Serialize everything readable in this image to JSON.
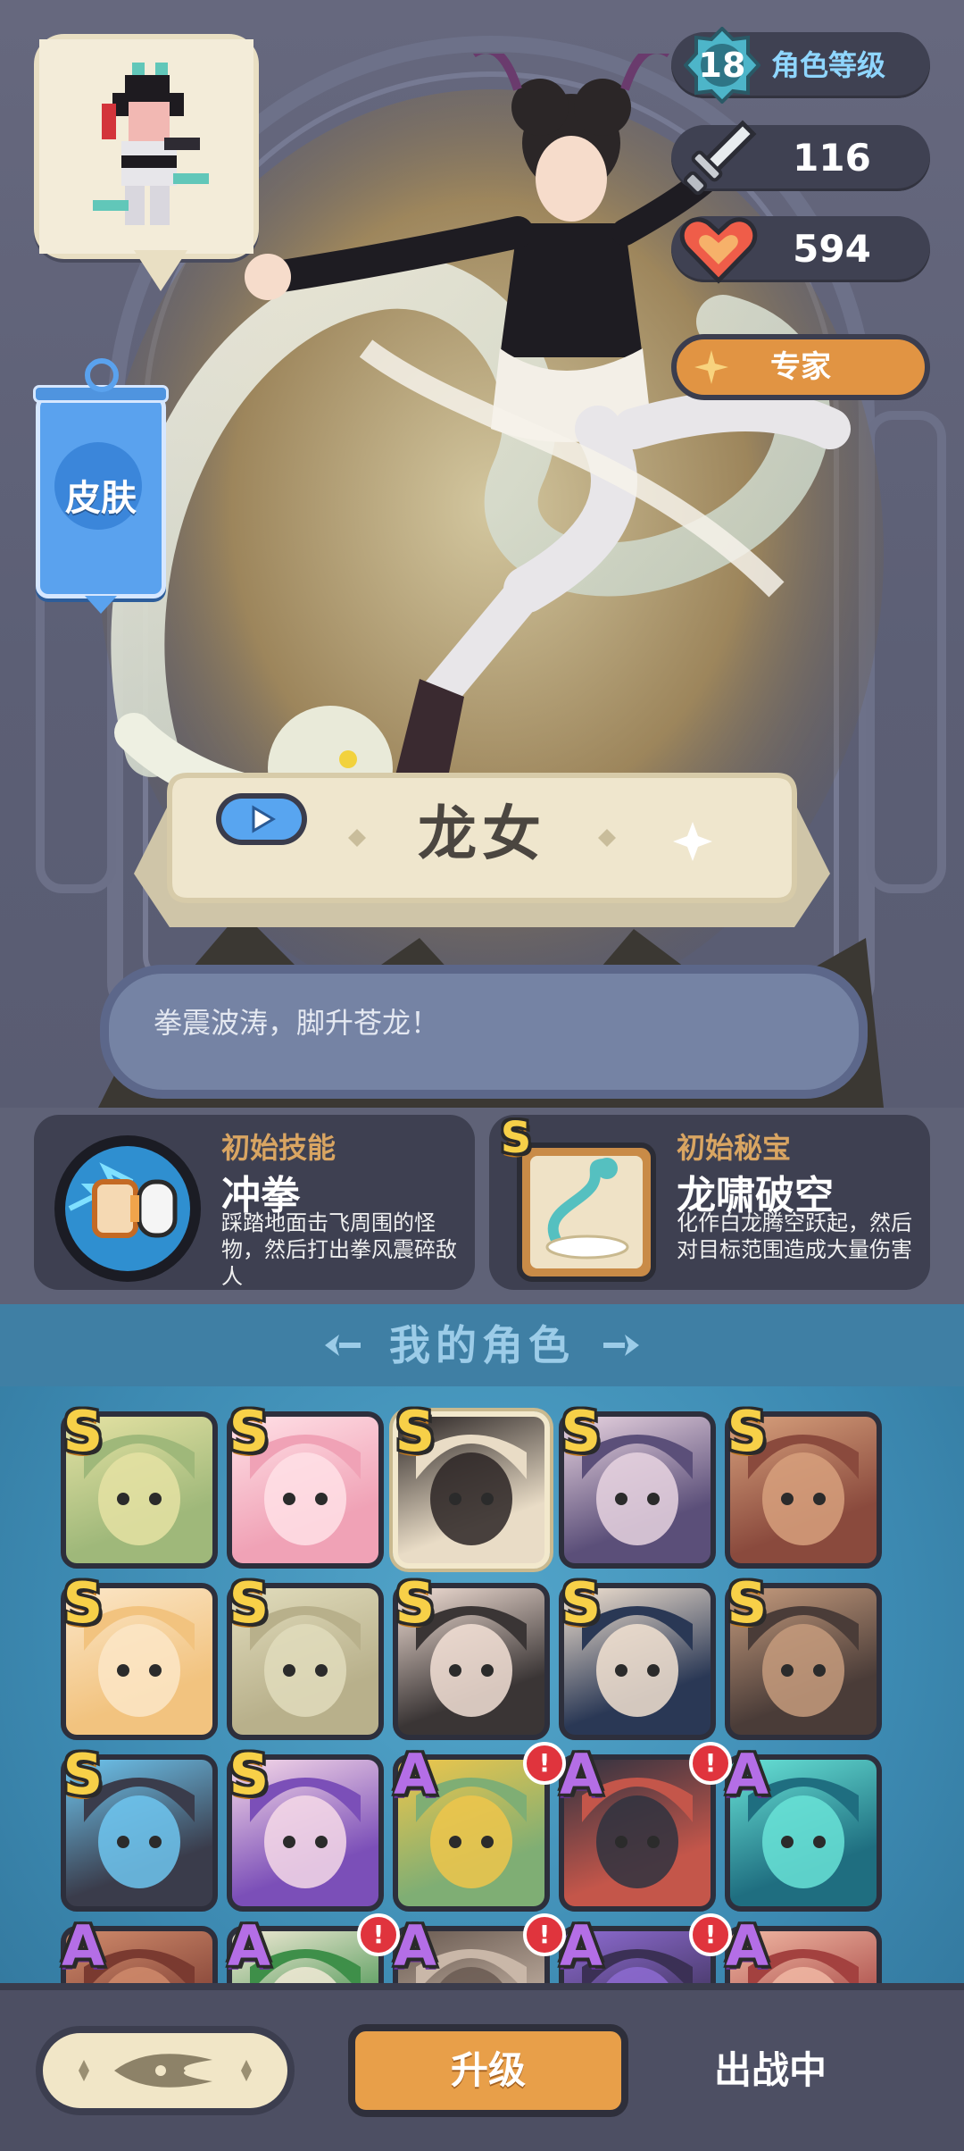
{
  "hero": {
    "skin_label": "皮肤",
    "level": "18",
    "level_label": "角色等级",
    "attack": "116",
    "health": "594",
    "rank_label": "专家",
    "name": "龙女",
    "quote": "拳震波涛，脚升苍龙！"
  },
  "skills": {
    "basic": {
      "tag": "初始技能",
      "name": "冲拳",
      "desc": "踩踏地面击飞周围的怪物，然后打出拳风震碎敌人"
    },
    "treasure": {
      "tag": "初始秘宝",
      "grade": "S",
      "name": "龙啸破空",
      "desc": "化作白龙腾空跃起，然后对目标范围造成大量伤害"
    }
  },
  "roster": {
    "title": "我的角色",
    "cards": [
      {
        "rank": "S",
        "color": "#9fb87a",
        "accent": "#e5e2a3",
        "alert": false,
        "selected": false
      },
      {
        "rank": "S",
        "color": "#f0a2b6",
        "accent": "#ffe0e6",
        "alert": false,
        "selected": false
      },
      {
        "rank": "S",
        "color": "#e9dcc6",
        "accent": "#2b2525",
        "alert": false,
        "selected": true
      },
      {
        "rank": "S",
        "color": "#5b4f79",
        "accent": "#e8d3e0",
        "alert": false,
        "selected": false
      },
      {
        "rank": "S",
        "color": "#8a4a3d",
        "accent": "#d7a07c",
        "alert": false,
        "selected": false
      },
      {
        "rank": "S",
        "color": "#f2c37f",
        "accent": "#fbe6c7",
        "alert": false,
        "selected": false
      },
      {
        "rank": "S",
        "color": "#b8b08b",
        "accent": "#e1dcbc",
        "alert": false,
        "selected": false
      },
      {
        "rank": "S",
        "color": "#3a3535",
        "accent": "#f3e0d6",
        "alert": false,
        "selected": false
      },
      {
        "rank": "S",
        "color": "#2a3855",
        "accent": "#f2e2d1",
        "alert": false,
        "selected": false
      },
      {
        "rank": "S",
        "color": "#4a3c38",
        "accent": "#c59b7d",
        "alert": false,
        "selected": false
      },
      {
        "rank": "S",
        "color": "#3a3c4b",
        "accent": "#6ec6f0",
        "alert": false,
        "selected": false
      },
      {
        "rank": "S",
        "color": "#7b4fb8",
        "accent": "#f6d9e8",
        "alert": false,
        "selected": false
      },
      {
        "rank": "A",
        "color": "#7fae74",
        "accent": "#efc64b",
        "alert": false,
        "selected": false
      },
      {
        "rank": "A",
        "color": "#c4564a",
        "accent": "#2f3240",
        "alert": true,
        "selected": false
      },
      {
        "rank": "A",
        "color": "#1f6e80",
        "accent": "#68e3d7",
        "alert": true,
        "selected": false
      },
      {
        "rank": "A",
        "color": "#7a3a30",
        "accent": "#cf8a6b",
        "alert": false,
        "selected": false
      },
      {
        "rank": "A",
        "color": "#3e8f49",
        "accent": "#f0e9d5",
        "alert": false,
        "selected": false
      },
      {
        "rank": "A",
        "color": "#c9b7a8",
        "accent": "#6a5b52",
        "alert": true,
        "selected": false
      },
      {
        "rank": "A",
        "color": "#3b3055",
        "accent": "#8d6bd1",
        "alert": true,
        "selected": false
      },
      {
        "rank": "A",
        "color": "#a3413f",
        "accent": "#f0b7a3",
        "alert": true,
        "selected": false
      }
    ]
  },
  "bottom": {
    "upgrade_label": "升级",
    "status_label": "出战中"
  },
  "colors": {
    "accent_gold": "#e19443",
    "roster_blue": "#3c89b1",
    "panel_dark": "#3e4051"
  }
}
